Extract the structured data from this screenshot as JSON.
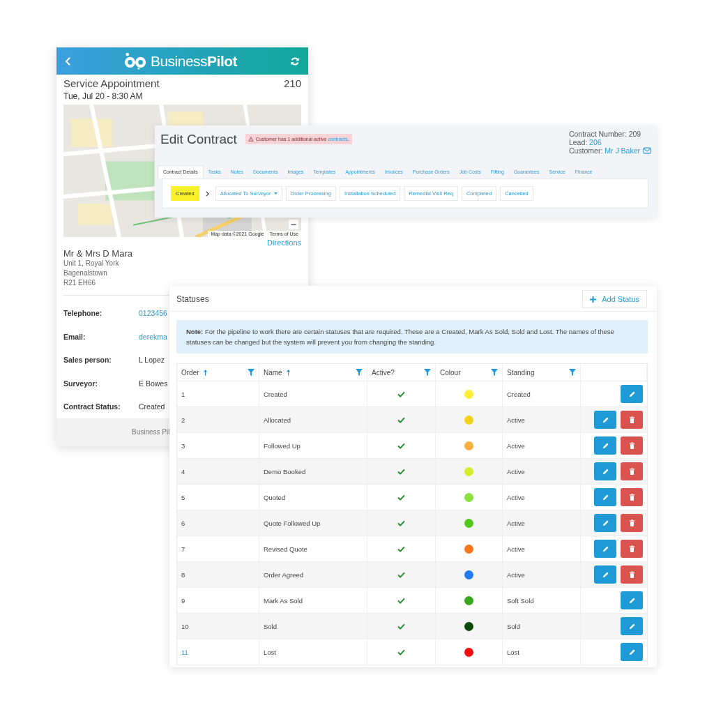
{
  "phone": {
    "brand": "Business**Pilot**",
    "title": "Service Appointment",
    "number": "210",
    "date": "Tue, Jul 20 - 8:30 AM",
    "map_credit": "Map data ©2021 Google",
    "map_terms": "Terms of Use",
    "directions": "Directions",
    "customer": "Mr & Mrs D Mara",
    "address": [
      "Unit 1, Royal York",
      "Bagenalstown",
      "R21 EH66"
    ],
    "fields": [
      {
        "label": "Telephone:",
        "value": "0123456",
        "link": true
      },
      {
        "label": "Email:",
        "value": "derekma",
        "link": true
      },
      {
        "label": "Sales person:",
        "value": "L Lopez",
        "link": false
      },
      {
        "label": "Surveyor:",
        "value": "E Bowes",
        "link": false
      },
      {
        "label": "Contract Status:",
        "value": "Created",
        "link": false
      }
    ],
    "footer": "Business Pil"
  },
  "contract": {
    "title": "Edit Contract",
    "alert": {
      "text": "Customer has 1 additional active",
      "link": "contracts",
      "end": "."
    },
    "number": "Contract Number: 209",
    "lead": {
      "label": "Lead:",
      "value": "206"
    },
    "customer": {
      "label": "Customer:",
      "value": "Mr J Baker"
    },
    "tabs": [
      {
        "label": "Contract Details",
        "selected": true
      },
      {
        "label": "Tasks",
        "selected": false
      },
      {
        "label": "Notes",
        "selected": false
      },
      {
        "label": "Documents",
        "selected": false
      },
      {
        "label": "Images",
        "selected": false
      },
      {
        "label": "Templates",
        "selected": false
      },
      {
        "label": "Appointments",
        "selected": false
      },
      {
        "label": "Invoices",
        "selected": false
      },
      {
        "label": "Purchase Orders",
        "selected": false
      },
      {
        "label": "Job Costs",
        "selected": false
      },
      {
        "label": "Fitting",
        "selected": false
      },
      {
        "label": "Guarantees",
        "selected": false
      },
      {
        "label": "Service",
        "selected": false
      },
      {
        "label": "Finance",
        "selected": false
      }
    ],
    "pipeline": [
      {
        "label": "Created",
        "kind": "current"
      },
      {
        "label": "Allocated To Surveyor",
        "kind": "dropdown"
      },
      {
        "label": "Order Processing",
        "kind": "step"
      },
      {
        "label": "Installation Scheduled",
        "kind": "step"
      },
      {
        "label": "Remedial Visit Req",
        "kind": "step"
      },
      {
        "label": "Completed",
        "kind": "step"
      },
      {
        "label": "Cancelled",
        "kind": "step"
      }
    ]
  },
  "statuses": {
    "title": "Statuses",
    "add_button": "Add Status",
    "note": "**Note:** For the pipeline to work there are certain statuses that are required. These are a Created, Mark As Sold, Sold and Lost. The names of these statuses can be changed but the system will prevent you from changing the standing.",
    "columns": [
      {
        "label": "Order",
        "sortable": true,
        "filter": true
      },
      {
        "label": "Name",
        "sortable": true,
        "filter": true
      },
      {
        "label": "Active?",
        "sortable": false,
        "filter": true
      },
      {
        "label": "Colour",
        "sortable": false,
        "filter": true
      },
      {
        "label": "Standing",
        "sortable": false,
        "filter": true
      }
    ],
    "rows": [
      {
        "order": "1",
        "name": "Created",
        "active": true,
        "color": "#fdf034",
        "standing": "Created",
        "deletable": false,
        "hovered": false
      },
      {
        "order": "2",
        "name": "Allocated",
        "active": true,
        "color": "#f2d21a",
        "standing": "Active",
        "deletable": true,
        "hovered": false
      },
      {
        "order": "3",
        "name": "Followed Up",
        "active": true,
        "color": "#fbb040",
        "standing": "Active",
        "deletable": true,
        "hovered": false
      },
      {
        "order": "4",
        "name": "Demo Booked",
        "active": true,
        "color": "#d4ec2c",
        "standing": "Active",
        "deletable": true,
        "hovered": false
      },
      {
        "order": "5",
        "name": "Quoted",
        "active": true,
        "color": "#8be23c",
        "standing": "Active",
        "deletable": true,
        "hovered": false
      },
      {
        "order": "6",
        "name": "Quote Followed Up",
        "active": true,
        "color": "#52c81a",
        "standing": "Active",
        "deletable": true,
        "hovered": false
      },
      {
        "order": "7",
        "name": "Revised Quote",
        "active": true,
        "color": "#f7771a",
        "standing": "Active",
        "deletable": true,
        "hovered": false
      },
      {
        "order": "8",
        "name": "Order Agreed",
        "active": true,
        "color": "#1f7bf2",
        "standing": "Active",
        "deletable": true,
        "hovered": false
      },
      {
        "order": "9",
        "name": "Mark As Sold",
        "active": true,
        "color": "#3aa81c",
        "standing": "Soft Sold",
        "deletable": false,
        "hovered": false
      },
      {
        "order": "10",
        "name": "Sold",
        "active": true,
        "color": "#0d4a0a",
        "standing": "Sold",
        "deletable": false,
        "hovered": false
      },
      {
        "order": "11",
        "name": "Lost",
        "active": true,
        "color": "#f50d0d",
        "standing": "Lost",
        "deletable": false,
        "hovered": true
      }
    ]
  }
}
